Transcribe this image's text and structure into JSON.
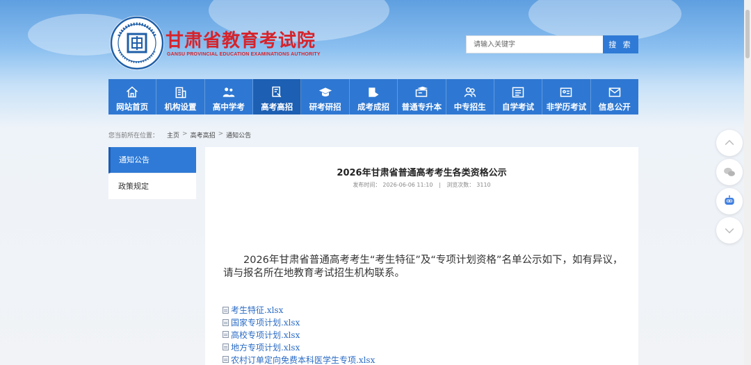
{
  "header": {
    "title": "甘肃省教育考试院",
    "subtitle": "GANSU PROVINCIAL EDUCATION EXAMINATIONS AUTHORITY",
    "logo_center": "国",
    "colors": {
      "brand_red": "#d6232b",
      "nav_blue": "#2e78d3",
      "nav_active": "#1c5fb3"
    }
  },
  "search": {
    "placeholder": "请输入关键字",
    "button_label": "搜 索"
  },
  "nav": {
    "items": [
      {
        "label": "网站首页",
        "icon": "home-icon"
      },
      {
        "label": "机构设置",
        "icon": "building-icon"
      },
      {
        "label": "高中学考",
        "icon": "students-icon"
      },
      {
        "label": "高考高招",
        "icon": "pen-doc-icon",
        "active": true
      },
      {
        "label": "研考研招",
        "icon": "graduation-cap-icon"
      },
      {
        "label": "成考成招",
        "icon": "book-flag-icon"
      },
      {
        "label": "普通专升本",
        "icon": "cap-screen-icon"
      },
      {
        "label": "中专招生",
        "icon": "people-icon"
      },
      {
        "label": "自学考试",
        "icon": "list-board-icon"
      },
      {
        "label": "非学历考试",
        "icon": "id-card-icon"
      },
      {
        "label": "信息公开",
        "icon": "mail-icon"
      }
    ]
  },
  "breadcrumb": {
    "lead": "您当前所在位置：",
    "items": [
      "主页",
      "高考高招",
      "通知公告"
    ],
    "sep": ">"
  },
  "sidebar": {
    "items": [
      {
        "label": "通知公告",
        "active": true
      },
      {
        "label": "政策规定"
      }
    ]
  },
  "article": {
    "title": "2026年甘肃省普通高考考生各类资格公示",
    "publish_label": "发布时间：",
    "publish_time": "2026-06-06 11:10",
    "meta_sep": "|",
    "views_label": "浏览次数：",
    "views": "3110",
    "body": "2026年甘肃省普通高考考生“考生特征”及“专项计划资格”名单公示如下，如有异议，请与报名所在地教育考试招生机构联系。",
    "files": [
      "考生特征.xlsx",
      "国家专项计划.xlsx",
      "高校专项计划.xlsx",
      "地方专项计划.xlsx",
      "农村订单定向免费本科医学生专项.xlsx"
    ]
  },
  "float_buttons": [
    "chevron-up-icon",
    "wechat-icon",
    "robot-icon",
    "chevron-down-icon"
  ]
}
